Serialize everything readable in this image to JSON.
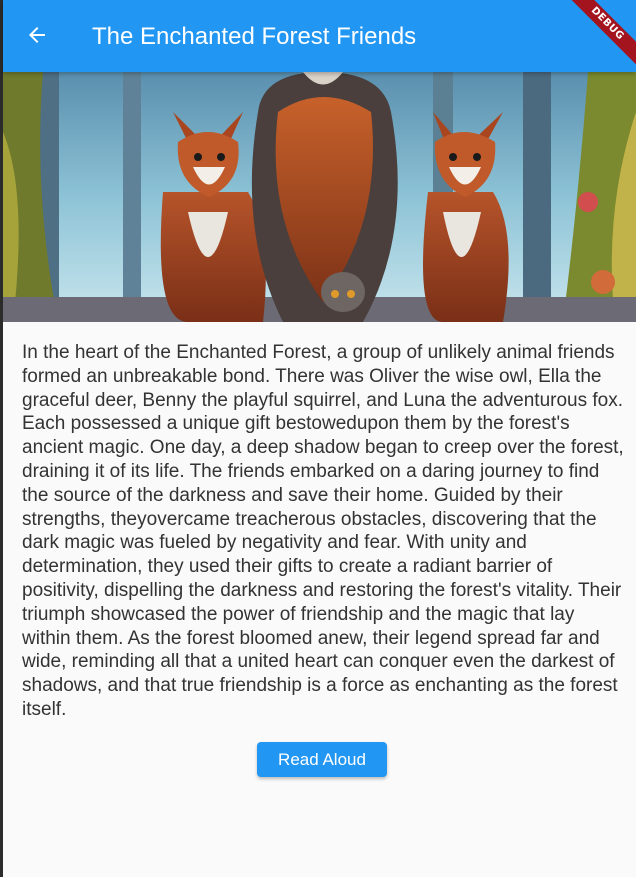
{
  "appbar": {
    "title": "The Enchanted Forest Friends",
    "back_icon": "arrow-back-icon",
    "debug_banner": "DEBUG",
    "color": "#2196f3"
  },
  "hero_image": {
    "subject": "illustration of two foxes and an owl in a forest"
  },
  "story": {
    "text": "In the heart of the Enchanted Forest, a group of unlikely animal friends formed an unbreakable bond. There was Oliver the wise owl, Ella the graceful deer, Benny the playful squirrel, and Luna the adventurous fox. Each possessed a unique gift bestowedupon them by the forest's ancient magic. One day, a deep shadow began to creep over the forest, draining it of its life. The friends embarked on a daring journey to find the source of the darkness and save their home. Guided by their strengths, theyovercame treacherous obstacles, discovering that the dark magic was fueled by negativity and fear. With unity and determination, they used their gifts to create a radiant barrier of positivity, dispelling the darkness and restoring the forest's vitality. Their triumph showcased the power of friendship and the magic that lay within them. As the forest bloomed anew, their legend spread far and wide, reminding all that a united heart can conquer even the darkest of shadows, and that true friendship is a force as enchanting as the forest itself."
  },
  "actions": {
    "read_aloud_label": "Read Aloud"
  }
}
